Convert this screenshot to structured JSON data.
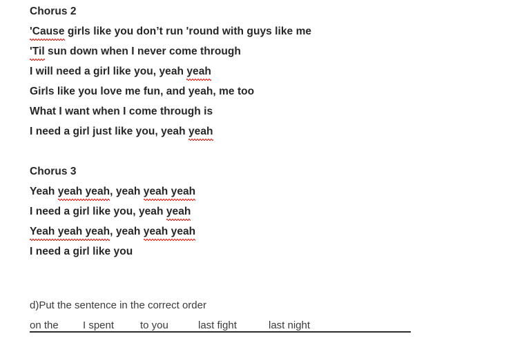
{
  "document": {
    "text_color": "#262626",
    "spellcheck_underline_color": "#e8322a",
    "rule_color": "#2b2b2b"
  },
  "chorus2": {
    "heading": "Chorus 2",
    "lines": [
      {
        "pre": "",
        "marked": "'Cause",
        "post": " girls like you don’t run 'round with guys like me"
      },
      {
        "pre": "",
        "marked": "'Til",
        "post": " sun down when I never come through"
      },
      {
        "pre": "I will need a girl like you, yeah ",
        "marked": "yeah",
        "post": ""
      },
      {
        "pre": "Girls like you love me fun, and yeah, me too",
        "marked": "",
        "post": ""
      },
      {
        "pre": "What I want when I come through is",
        "marked": "",
        "post": ""
      },
      {
        "pre": "I need a girl just like you, yeah ",
        "marked": "yeah",
        "post": ""
      }
    ]
  },
  "chorus3": {
    "heading": "Chorus 3",
    "line1": {
      "a": "Yeah ",
      "b": "yeah yeah",
      "c": ", yeah ",
      "d": "yeah yeah"
    },
    "line2": {
      "a": "I need a girl like you, yeah ",
      "b": "yeah"
    },
    "line3": {
      "a": "Yeah yeah yeah",
      "b": ", yeah ",
      "c": "yeah yeah"
    },
    "line4": "I need a girl like you"
  },
  "exercise": {
    "instruction": "d)Put the sentence in the correct order",
    "word_chips": [
      "on the",
      "I spent",
      "to you",
      "last fight",
      "last night"
    ],
    "answer_line": ""
  }
}
